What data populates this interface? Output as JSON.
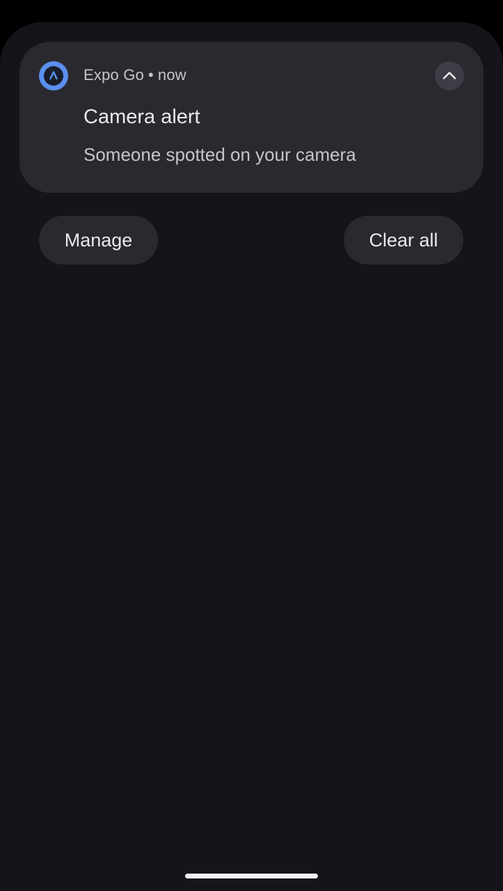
{
  "notification": {
    "app_name": "Expo Go",
    "separator": "•",
    "time": "now",
    "title": "Camera alert",
    "body": "Someone spotted on your camera",
    "app_icon": "expo-go-icon",
    "expand_icon": "chevron-up-icon"
  },
  "actions": {
    "manage_label": "Manage",
    "clear_all_label": "Clear all"
  },
  "colors": {
    "background": "#16141b",
    "card": "#2b2930",
    "accent": "#5a8fee",
    "primary_text": "#ece8ef",
    "secondary_text": "#c7c4cc"
  }
}
